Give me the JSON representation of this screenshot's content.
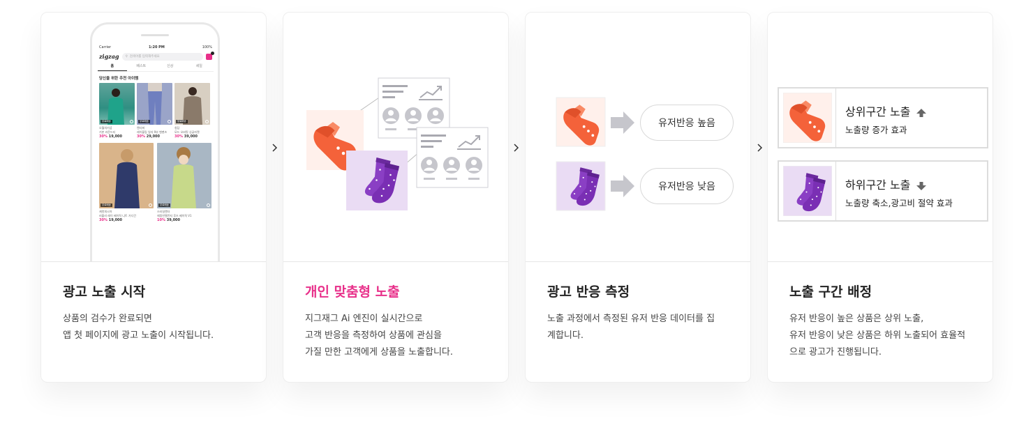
{
  "phone": {
    "status_carrier": "Carrier",
    "status_time": "1:20 PM",
    "status_battery": "100%",
    "app_logo": "zigzag",
    "search_placeholder": "검색어를 입력해주세요",
    "tabs": [
      "홈",
      "베스트",
      "신상",
      "세일"
    ],
    "section_title": "당신을 위한 추천 아이템",
    "products_top": [
      {
        "name": "오월의기념",
        "sub": "기본 라운드티",
        "percent": "30%",
        "price": "19,000",
        "tag": "무료배송"
      },
      {
        "name": "렌더퍼",
        "sub": "레이블링 일자 9부 밴팬츠",
        "percent": "30%",
        "price": "29,000",
        "tag": "무료배송"
      },
      {
        "name": "청담",
        "sub": "모드 오버핏 싱글자켓",
        "percent": "30%",
        "price": "39,000",
        "tag": "무료배송"
      }
    ],
    "products_bottom": [
      {
        "name": "캐럿피시아",
        "sub": "러블리 레이 베이직 니트 가디건",
        "percent": "30%",
        "price": "19,000",
        "tag": "무료배송"
      },
      {
        "name": "스타일랜더",
        "sub": "헤링빈멜란지 루즈 베이직 V1",
        "percent": "10%",
        "price": "39,000",
        "tag": "무료배송"
      }
    ]
  },
  "cards": [
    {
      "title": "광고 노출 시작",
      "desc": [
        "상품의 검수가 완료되면",
        "앱 첫 페이지에 광고 노출이 시작됩니다."
      ]
    },
    {
      "title": "개인 맞춤형 노출",
      "desc": [
        "지그재그 Ai 엔진이 실시간으로",
        "고객 반응을 측정하여 상품에 관심을",
        "가질 만한 고객에게 상품을 노출합니다."
      ]
    },
    {
      "title": "광고 반응 측정",
      "desc": [
        "노출 과정에서 측정된 유저 반응 데이터를 집",
        "계합니다."
      ]
    },
    {
      "title": "노출 구간 배정",
      "desc": [
        "유저 반응이 높은 상품은 상위 노출,",
        "유저 반응이 낮은 상품은 하위 노출되어 효율적",
        "으로 광고가 진행됩니다."
      ]
    }
  ],
  "response": {
    "high": "유저반응 높음",
    "low": "유저반응 낮음"
  },
  "tiers": {
    "upper_title": "상위구간 노출",
    "upper_sub": "노출량 증가 효과",
    "lower_title": "하위구간 노출",
    "lower_sub": "노출량 축소,광고비 절약 효과"
  },
  "colors": {
    "accent": "#e8308a",
    "orange": "#f4623a",
    "purple": "#8a3fc4"
  }
}
